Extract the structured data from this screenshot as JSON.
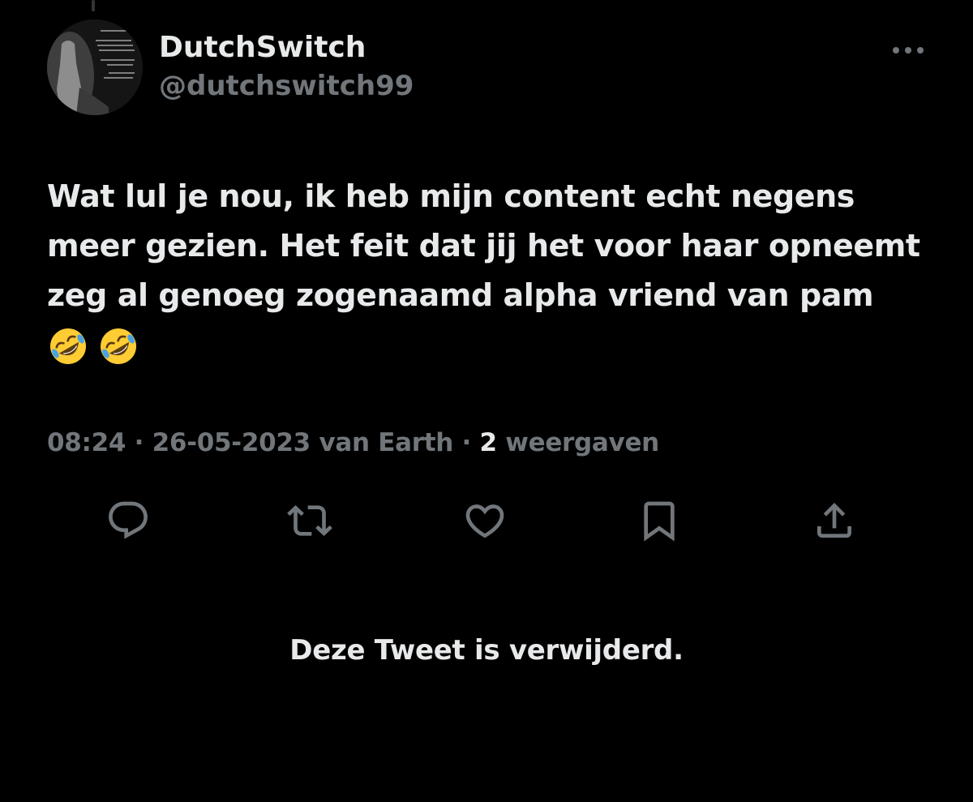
{
  "tweet": {
    "author": {
      "display_name": "DutchSwitch",
      "handle": "@dutchswitch99",
      "avatar": "profile-photo-monochrome"
    },
    "text_lines": [
      "Wat lul je nou, ik heb mijn content echt negens",
      "meer gezien. Het feit dat jij het voor haar opneemt",
      "zeg al genoeg zogenaamd alpha vriend van pam"
    ],
    "emojis": [
      "rolling-on-floor-laughing",
      "rolling-on-floor-laughing"
    ],
    "meta": {
      "time": "08:24",
      "separator": " · ",
      "date": "26-05-2023",
      "source": "van Earth",
      "views_count": "2",
      "views_label": " weergaven"
    },
    "actions": [
      {
        "name": "reply",
        "icon": "reply-icon"
      },
      {
        "name": "retweet",
        "icon": "retweet-icon"
      },
      {
        "name": "like",
        "icon": "heart-icon"
      },
      {
        "name": "bookmark",
        "icon": "bookmark-icon"
      },
      {
        "name": "share",
        "icon": "share-icon"
      }
    ]
  },
  "deleted_notice": "Deze Tweet is verwijderd.",
  "colors": {
    "background": "#000000",
    "primary_text": "#e7e9ea",
    "secondary_text": "#71767b",
    "icon": "#71767b",
    "emoji_face": "#ffcc33",
    "emoji_tears": "#4aa3df"
  }
}
